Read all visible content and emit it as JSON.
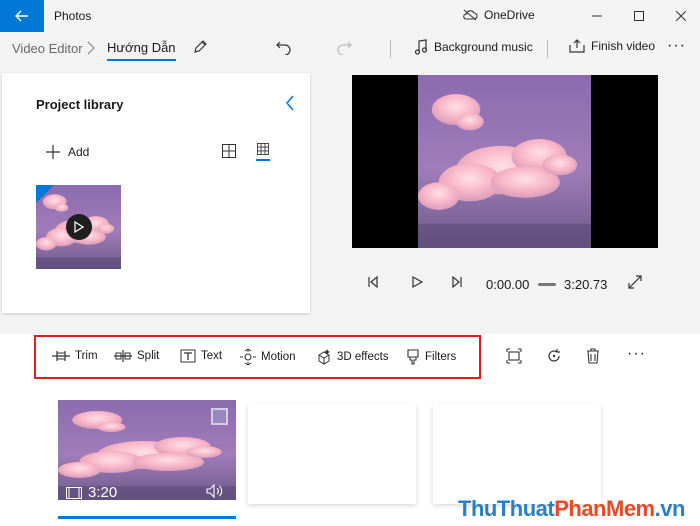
{
  "window": {
    "app_title": "Photos",
    "onedrive_label": "OneDrive",
    "controls": [
      "minimize-icon",
      "maximize-icon",
      "close-icon"
    ]
  },
  "breadcrumb": {
    "root": "Video Editor",
    "current": "Hướng Dẫn"
  },
  "command_bar": {
    "background_music": "Background music",
    "finish_video": "Finish video",
    "more": "···"
  },
  "library": {
    "title": "Project library",
    "add_label": "Add"
  },
  "player": {
    "current_time": "0:00.00",
    "total_time": "3:20.73"
  },
  "edit_tools": [
    {
      "label": "Trim",
      "icon": "trim-icon"
    },
    {
      "label": "Split",
      "icon": "split-icon"
    },
    {
      "label": "Text",
      "icon": "text-icon"
    },
    {
      "label": "Motion",
      "icon": "motion-icon"
    },
    {
      "label": "3D effects",
      "icon": "3d-effects-icon"
    },
    {
      "label": "Filters",
      "icon": "filters-icon"
    }
  ],
  "edit_more": "···",
  "storyboard": {
    "clip_duration": "3:20"
  },
  "watermark": {
    "part1": "ThuThuat",
    "part2": "PhanMem",
    "part3": ".vn"
  },
  "colors": {
    "accent": "#0078d7",
    "highlight_frame": "#e02020"
  }
}
